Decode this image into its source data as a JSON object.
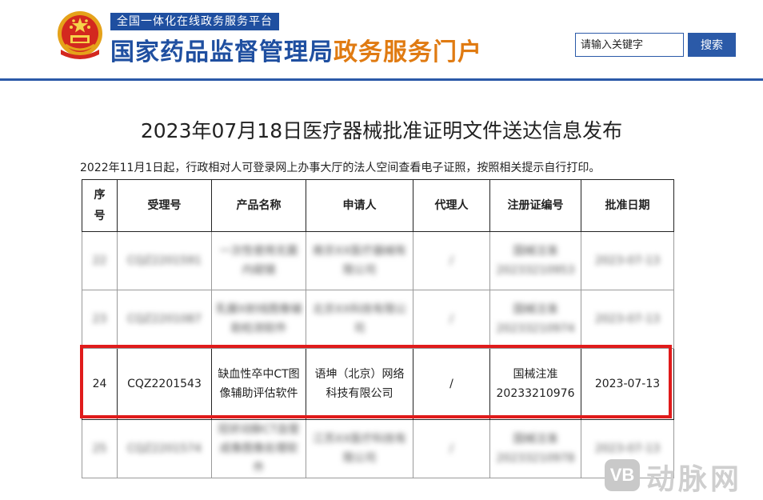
{
  "header": {
    "platform_tag": "全国一体化在线政务服务平台",
    "title_main": "国家药品监督管理局",
    "title_accent": "政务服务门户",
    "search_placeholder": "请输入关键字",
    "search_button": "搜索"
  },
  "colors": {
    "brand_blue": "#2b5aa8",
    "accent_orange": "#e07b12",
    "highlight_red": "#e01b1b"
  },
  "page_title": "2023年07月18日医疗器械批准证明文件送达信息发布",
  "notice": "2022年11月1日起，行政相对人可登录网上办事大厅的法人空间查看电子证照，按照相关提示自行打印。",
  "table": {
    "headers": [
      "序号",
      "受理号",
      "产品名称",
      "申请人",
      "代理人",
      "注册证编号",
      "批准日期"
    ],
    "rows": [
      {
        "blurred": true,
        "cells": [
          "22",
          "CQZ2201591",
          "一次性使用无菌内窥镜",
          "南京XX医疗器械有限公司",
          "/",
          "国械注准20233210953",
          "2023-07-13"
        ]
      },
      {
        "blurred": true,
        "cells": [
          "23",
          "CQZ2201087",
          "乳腺X射线图像辅助检测软件",
          "北京XX科技有限公司",
          "/",
          "国械注准20233210974",
          "2023-07-13"
        ]
      },
      {
        "blurred": false,
        "cells": [
          "24",
          "CQZ2201543",
          "缺血性卒中CT图像辅助评估软件",
          "语坤（北京）网络科技有限公司",
          "/",
          "国械注准20233210976",
          "2023-07-13"
        ]
      },
      {
        "blurred": true,
        "cells": [
          "25",
          "CQZ2201574",
          "冠状动脉CT血管成像图像处理软件",
          "江苏XX医疗科技有限公司",
          "/",
          "国械注准20233210978",
          "2023-07-13"
        ]
      }
    ]
  },
  "watermark": {
    "badge": "VB",
    "text": "动脉网"
  }
}
